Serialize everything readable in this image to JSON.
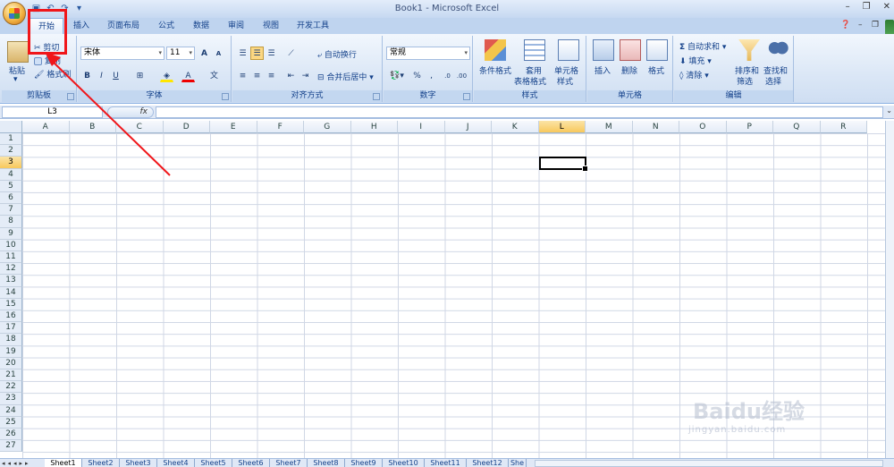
{
  "window": {
    "title": "Book1 - Microsoft Excel"
  },
  "tabs": [
    "开始",
    "插入",
    "页面布局",
    "公式",
    "数据",
    "审阅",
    "视图",
    "开发工具"
  ],
  "ribbon": {
    "clipboard": {
      "paste": "粘贴",
      "cut": "剪切",
      "copy": "复制",
      "format_painter": "格式刷",
      "label": "剪贴板"
    },
    "font": {
      "name": "宋体",
      "size": "11",
      "label": "字体",
      "bold": "B",
      "italic": "I",
      "underline": "U",
      "grow": "A",
      "shrink": "A"
    },
    "alignment": {
      "wrap_text": "自动换行",
      "merge_center": "合并后居中",
      "label": "对齐方式"
    },
    "number": {
      "format": "常规",
      "percent": "%",
      "comma": ",",
      "label": "数字"
    },
    "styles": {
      "conditional": "条件格式",
      "table_format_line1": "套用",
      "table_format_line2": "表格格式",
      "cell_styles_line1": "单元格",
      "cell_styles_line2": "样式",
      "label": "样式"
    },
    "cells": {
      "insert": "插入",
      "delete": "删除",
      "format": "格式",
      "label": "单元格"
    },
    "editing": {
      "autosum": "自动求和",
      "fill": "填充",
      "clear": "清除",
      "sort_line1": "排序和",
      "sort_line2": "筛选",
      "find_line1": "查找和",
      "find_line2": "选择",
      "label": "编辑"
    }
  },
  "formula_bar": {
    "name_box": "L3",
    "fx": "fx"
  },
  "grid": {
    "columns": [
      "A",
      "B",
      "C",
      "D",
      "E",
      "F",
      "G",
      "H",
      "I",
      "J",
      "K",
      "L",
      "M",
      "N",
      "O",
      "P",
      "Q",
      "R"
    ],
    "rows": [
      "1",
      "2",
      "3",
      "4",
      "5",
      "6",
      "7",
      "8",
      "9",
      "10",
      "11",
      "12",
      "13",
      "14",
      "15",
      "16",
      "17",
      "18",
      "19",
      "20",
      "21",
      "22",
      "23",
      "24",
      "25",
      "26",
      "27"
    ],
    "selected_col": "L",
    "selected_row": "3"
  },
  "sheets": [
    "Sheet1",
    "Sheet2",
    "Sheet3",
    "Sheet4",
    "Sheet5",
    "Sheet6",
    "Sheet7",
    "Sheet8",
    "Sheet9",
    "Sheet10",
    "Sheet11",
    "Sheet12",
    "She"
  ],
  "active_sheet": "Sheet1",
  "watermark": {
    "text": "Baidu经验",
    "url": "jingyan.baidu.com"
  },
  "colors": {
    "accent": "#15428b",
    "annotation": "#f0161a",
    "selection": "#f8c85c"
  }
}
